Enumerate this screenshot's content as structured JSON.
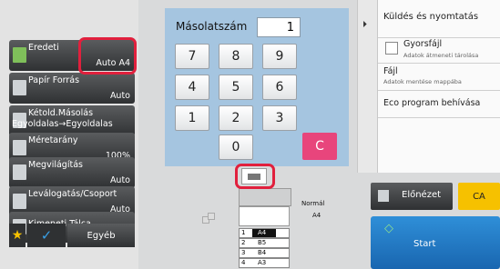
{
  "left_menu": {
    "original": {
      "label": "Eredeti",
      "value": "Auto  A4"
    },
    "paper": {
      "label": "Papír Forrás",
      "value": "Auto"
    },
    "duplex": {
      "label": "Kétold.Másolás",
      "value": "Egyoldalas→Egyoldalas"
    },
    "ratio": {
      "label": "Méretarány",
      "value": "100%"
    },
    "exposure": {
      "label": "Megvilágítás",
      "value": "Auto"
    },
    "sort": {
      "label": "Leválogatás/Csoport",
      "value": "Auto"
    },
    "output": {
      "label": "Kimeneti Tálca"
    },
    "other_label": "Egyéb"
  },
  "keypad": {
    "copies_label": "Másolatszám",
    "copies_value": "1",
    "keys": [
      "7",
      "8",
      "9",
      "4",
      "5",
      "6",
      "1",
      "2",
      "3",
      "0"
    ],
    "clear": "C"
  },
  "right_panel": {
    "send_print": "Küldés és nyomtatás",
    "quick_file": "Gyorsfájl",
    "quick_file_sub": "Adatok átmeneti tárolása",
    "file": "Fájl",
    "file_sub": "Adatok mentése mappába",
    "eco": "Eco program behívása"
  },
  "preview": {
    "normal_label": "Normál",
    "normal_size": "A4",
    "trays": [
      {
        "num": "1",
        "size": "A4"
      },
      {
        "num": "2",
        "size": "B5"
      },
      {
        "num": "3",
        "size": "B4"
      },
      {
        "num": "4",
        "size": "A3"
      }
    ]
  },
  "actions": {
    "preview_label": "Előnézet",
    "ca_label": "CA",
    "start_label": "Start"
  },
  "colors": {
    "highlight": "#e1203d",
    "clear_key": "#e8457c",
    "start": "#1a6fbf",
    "ca": "#f6c100"
  }
}
